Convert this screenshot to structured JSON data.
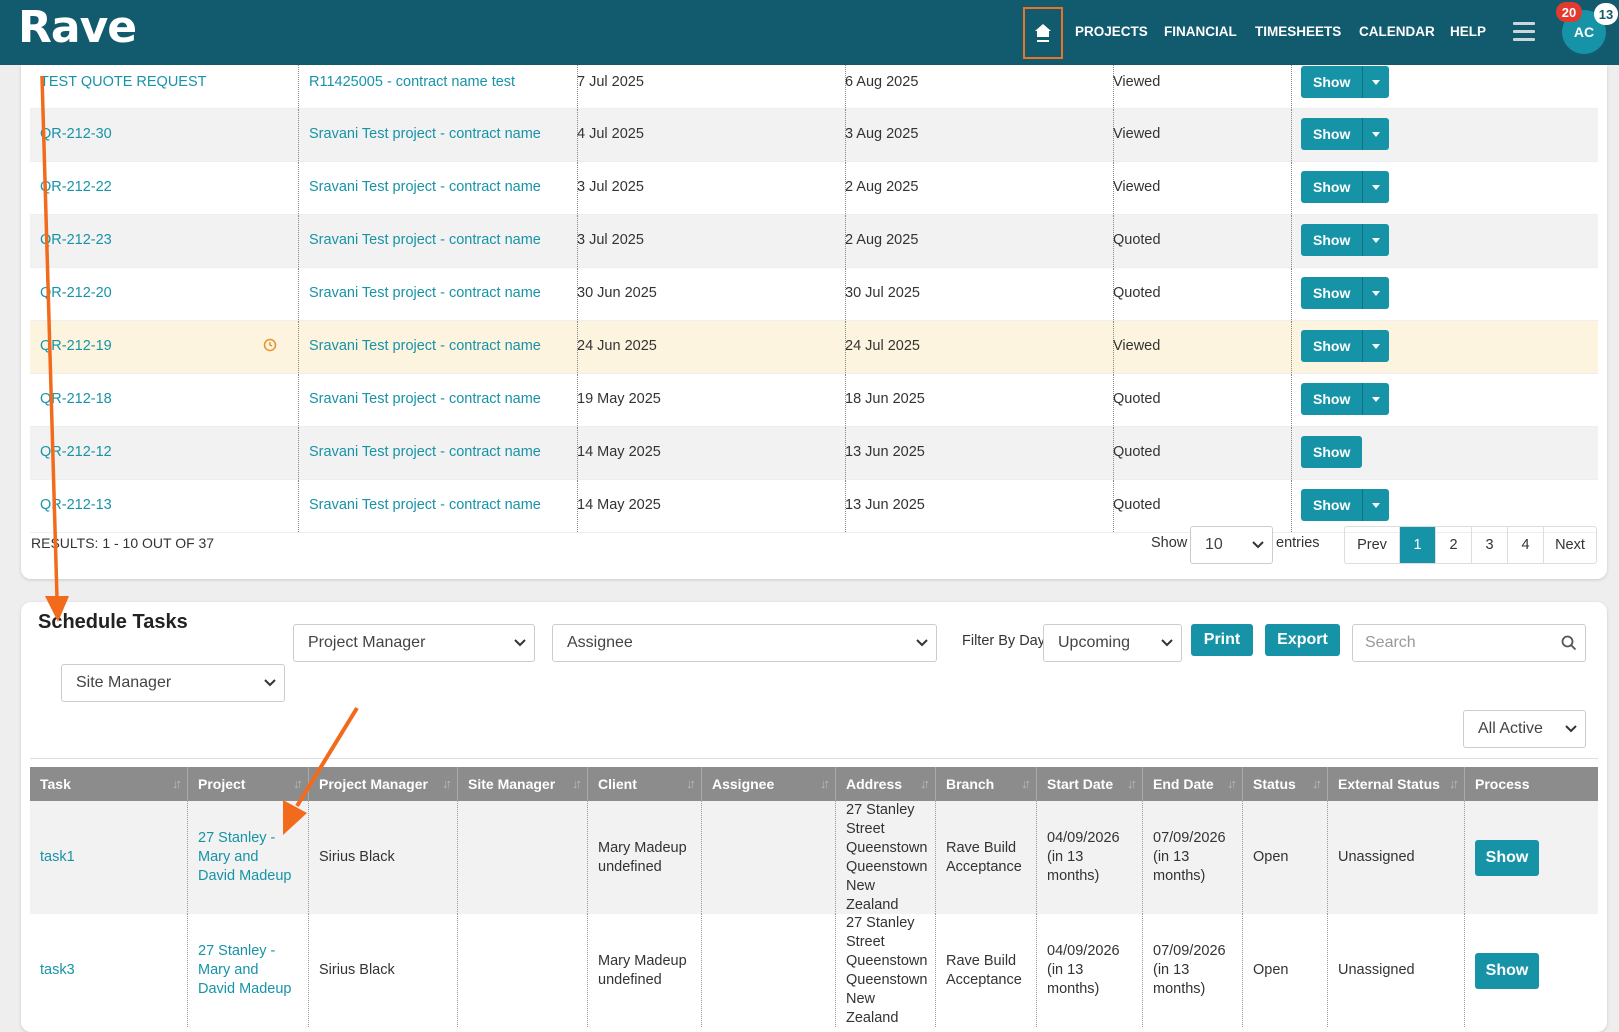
{
  "header": {
    "logo": "Rave",
    "nav": [
      "PROJECTS",
      "FINANCIAL",
      "TIMESHEETS",
      "CALENDAR",
      "HELP"
    ],
    "avatar_initials": "AC",
    "notification_count": "20",
    "message_count": "13"
  },
  "quotes": {
    "rows": [
      {
        "ref": "TEST QUOTE REQUEST",
        "project": "R11425005 - contract name test",
        "date": "7 Jul 2025",
        "expiry": "6 Aug 2025",
        "status": "Viewed",
        "show": "Show",
        "split": true
      },
      {
        "ref": "QR-212-30",
        "project": "Sravani Test project - contract name",
        "date": "4 Jul 2025",
        "expiry": "3 Aug 2025",
        "status": "Viewed",
        "show": "Show",
        "split": true
      },
      {
        "ref": "QR-212-22",
        "project": "Sravani Test project - contract name",
        "date": "3 Jul 2025",
        "expiry": "2 Aug 2025",
        "status": "Viewed",
        "show": "Show",
        "split": true
      },
      {
        "ref": "QR-212-23",
        "project": "Sravani Test project - contract name",
        "date": "3 Jul 2025",
        "expiry": "2 Aug 2025",
        "status": "Quoted",
        "show": "Show",
        "split": true
      },
      {
        "ref": "QR-212-20",
        "project": "Sravani Test project - contract name",
        "date": "30 Jun 2025",
        "expiry": "30 Jul 2025",
        "status": "Quoted",
        "show": "Show",
        "split": true
      },
      {
        "ref": "QR-212-19",
        "project": "Sravani Test project - contract name",
        "date": "24 Jun 2025",
        "expiry": "24 Jul 2025",
        "status": "Viewed",
        "show": "Show",
        "split": true
      },
      {
        "ref": "QR-212-18",
        "project": "Sravani Test project - contract name",
        "date": "19 May 2025",
        "expiry": "18 Jun 2025",
        "status": "Quoted",
        "show": "Show",
        "split": true
      },
      {
        "ref": "QR-212-12",
        "project": "Sravani Test project - contract name",
        "date": "14 May 2025",
        "expiry": "13 Jun 2025",
        "status": "Quoted",
        "show": "Show",
        "split": false
      },
      {
        "ref": "QR-212-13",
        "project": "Sravani Test project - contract name",
        "date": "14 May 2025",
        "expiry": "13 Jun 2025",
        "status": "Quoted",
        "show": "Show",
        "split": true
      }
    ],
    "results_text": "RESULTS: 1 - 10 OUT OF 37",
    "show_label": "Show",
    "page_size": "10",
    "entries_label": "entries",
    "pager": [
      "Prev",
      "1",
      "2",
      "3",
      "4",
      "Next"
    ]
  },
  "schedule": {
    "title": "Schedule Tasks",
    "project_manager": "Project Manager",
    "assignee": "Assignee",
    "filter_label": "Filter By Days",
    "filter_value": "Upcoming",
    "print": "Print",
    "export": "Export",
    "search_placeholder": "Search",
    "site_manager": "Site Manager",
    "status_filter": "All Active",
    "columns": [
      "Task",
      "Project",
      "Project Manager",
      "Site Manager",
      "Client",
      "Assignee",
      "Address",
      "Branch",
      "Start Date",
      "End Date",
      "Status",
      "External Status",
      "Process"
    ],
    "rows": [
      {
        "task": "task1",
        "project": "27 Stanley - Mary and David Madeup",
        "pm": "Sirius Black",
        "sm": "",
        "client": "Mary Madeup undefined",
        "assignee": "",
        "address": "27 Stanley Street Queenstown Queenstown New Zealand",
        "branch": "Rave Build Acceptance",
        "start": "04/09/2026 (in 13 months)",
        "end": "07/09/2026 (in 13 months)",
        "status": "Open",
        "ext_status": "Unassigned",
        "process": "Show"
      },
      {
        "task": "task3",
        "project": "27 Stanley - Mary and David Madeup",
        "pm": "Sirius Black",
        "sm": "",
        "client": "Mary Madeup undefined",
        "assignee": "",
        "address": "27 Stanley Street Queenstown Queenstown New Zealand",
        "branch": "Rave Build Acceptance",
        "start": "04/09/2026 (in 13 months)",
        "end": "07/09/2026 (in 13 months)",
        "status": "Open",
        "ext_status": "Unassigned",
        "process": "Show"
      }
    ]
  },
  "colors": {
    "header": "#125a6e",
    "accent": "#1793a8",
    "annotation": "#f26a1b",
    "highlight_row": "#fcf4de"
  }
}
